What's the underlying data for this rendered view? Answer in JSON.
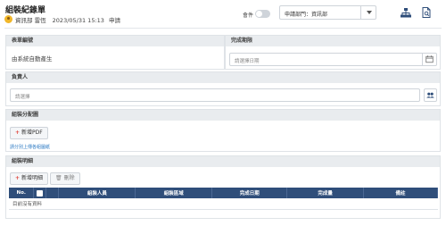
{
  "header": {
    "title": "組裝紀錄單",
    "user": "資訊部 雷恆",
    "datetime": "2023/05/31 15:13",
    "status": "申請",
    "toggle_label": "會件",
    "dept_select": "申請部門：資訊部",
    "icons": [
      "org-chart-icon",
      "document-icon",
      "chevron-down-icon",
      "calendar-icon",
      "user-group-icon"
    ]
  },
  "form_number": {
    "label": "表單編號",
    "value": "由系統自動產生"
  },
  "due_date": {
    "label": "完成期限",
    "placeholder": "請選擇日期"
  },
  "responsible": {
    "label": "負責人",
    "placeholder": "請選擇"
  },
  "assembly_allocation": {
    "label": "組裝分配圖",
    "add_pdf_label": "新增PDF",
    "upload_hint": "請分別上傳各組圖紙"
  },
  "assembly_detail": {
    "label": "組裝明細",
    "add_label": "新增明細",
    "delete_label": "刪除",
    "columns": [
      "No.",
      "",
      "組裝人員",
      "組裝區域",
      "完成日期",
      "完成量",
      "備註"
    ],
    "empty_text": "目前沒有資料"
  }
}
